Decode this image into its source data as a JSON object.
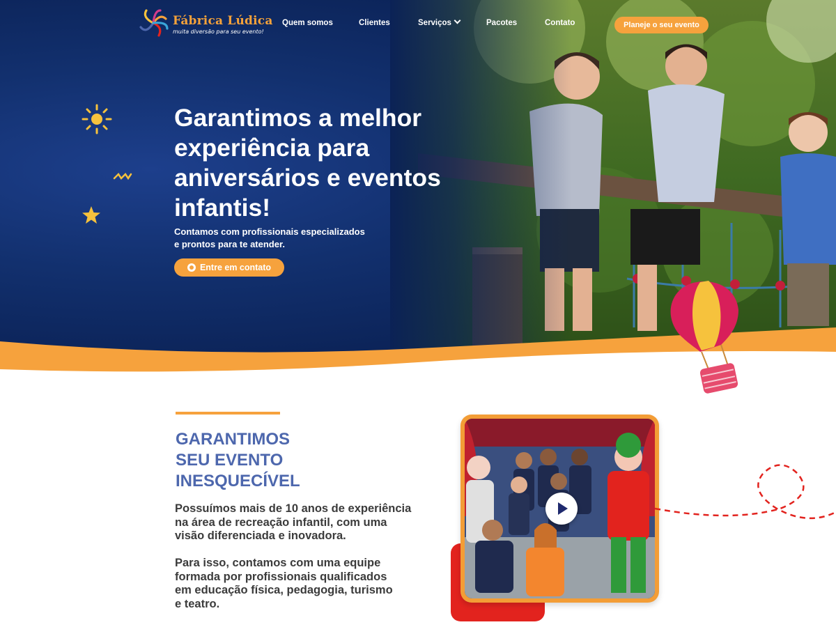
{
  "brand": {
    "name": "Fábrica Lúdica",
    "tagline": "muita diversão para seu evento!",
    "logo_icon": "swirl-logo-icon"
  },
  "nav": {
    "items": [
      {
        "label": "Quem somos"
      },
      {
        "label": "Clientes"
      },
      {
        "label": "Serviços",
        "has_dropdown": true
      },
      {
        "label": "Pacotes"
      },
      {
        "label": "Contato"
      }
    ],
    "cta_label": "Planeje o seu evento"
  },
  "hero": {
    "title": "Garantimos a melhor experiência para aniversários e eventos infantis!",
    "subtitle": "Contamos com profissionais especializados\ne prontos para te atender.",
    "button_label": "Entre em contato",
    "button_icon": "whatsapp-icon"
  },
  "about": {
    "title": "GARANTIMOS\nSEU EVENTO\nINESQUECÍVEL",
    "paragraph_1": "Possuímos mais de 10 anos de experiência\nna área de recreação infantil, com uma\nvisão diferenciada e inovadora.",
    "paragraph_2": "Para isso, contamos com uma equipe\nformada por profissionais qualificados\nem educação física, pedagogia, turismo\ne teatro.",
    "video_icon": "play-icon"
  },
  "colors": {
    "navy": "#0b2256",
    "orange": "#f6a23d",
    "title_blue": "#4d67ad",
    "red": "#e2231e"
  }
}
